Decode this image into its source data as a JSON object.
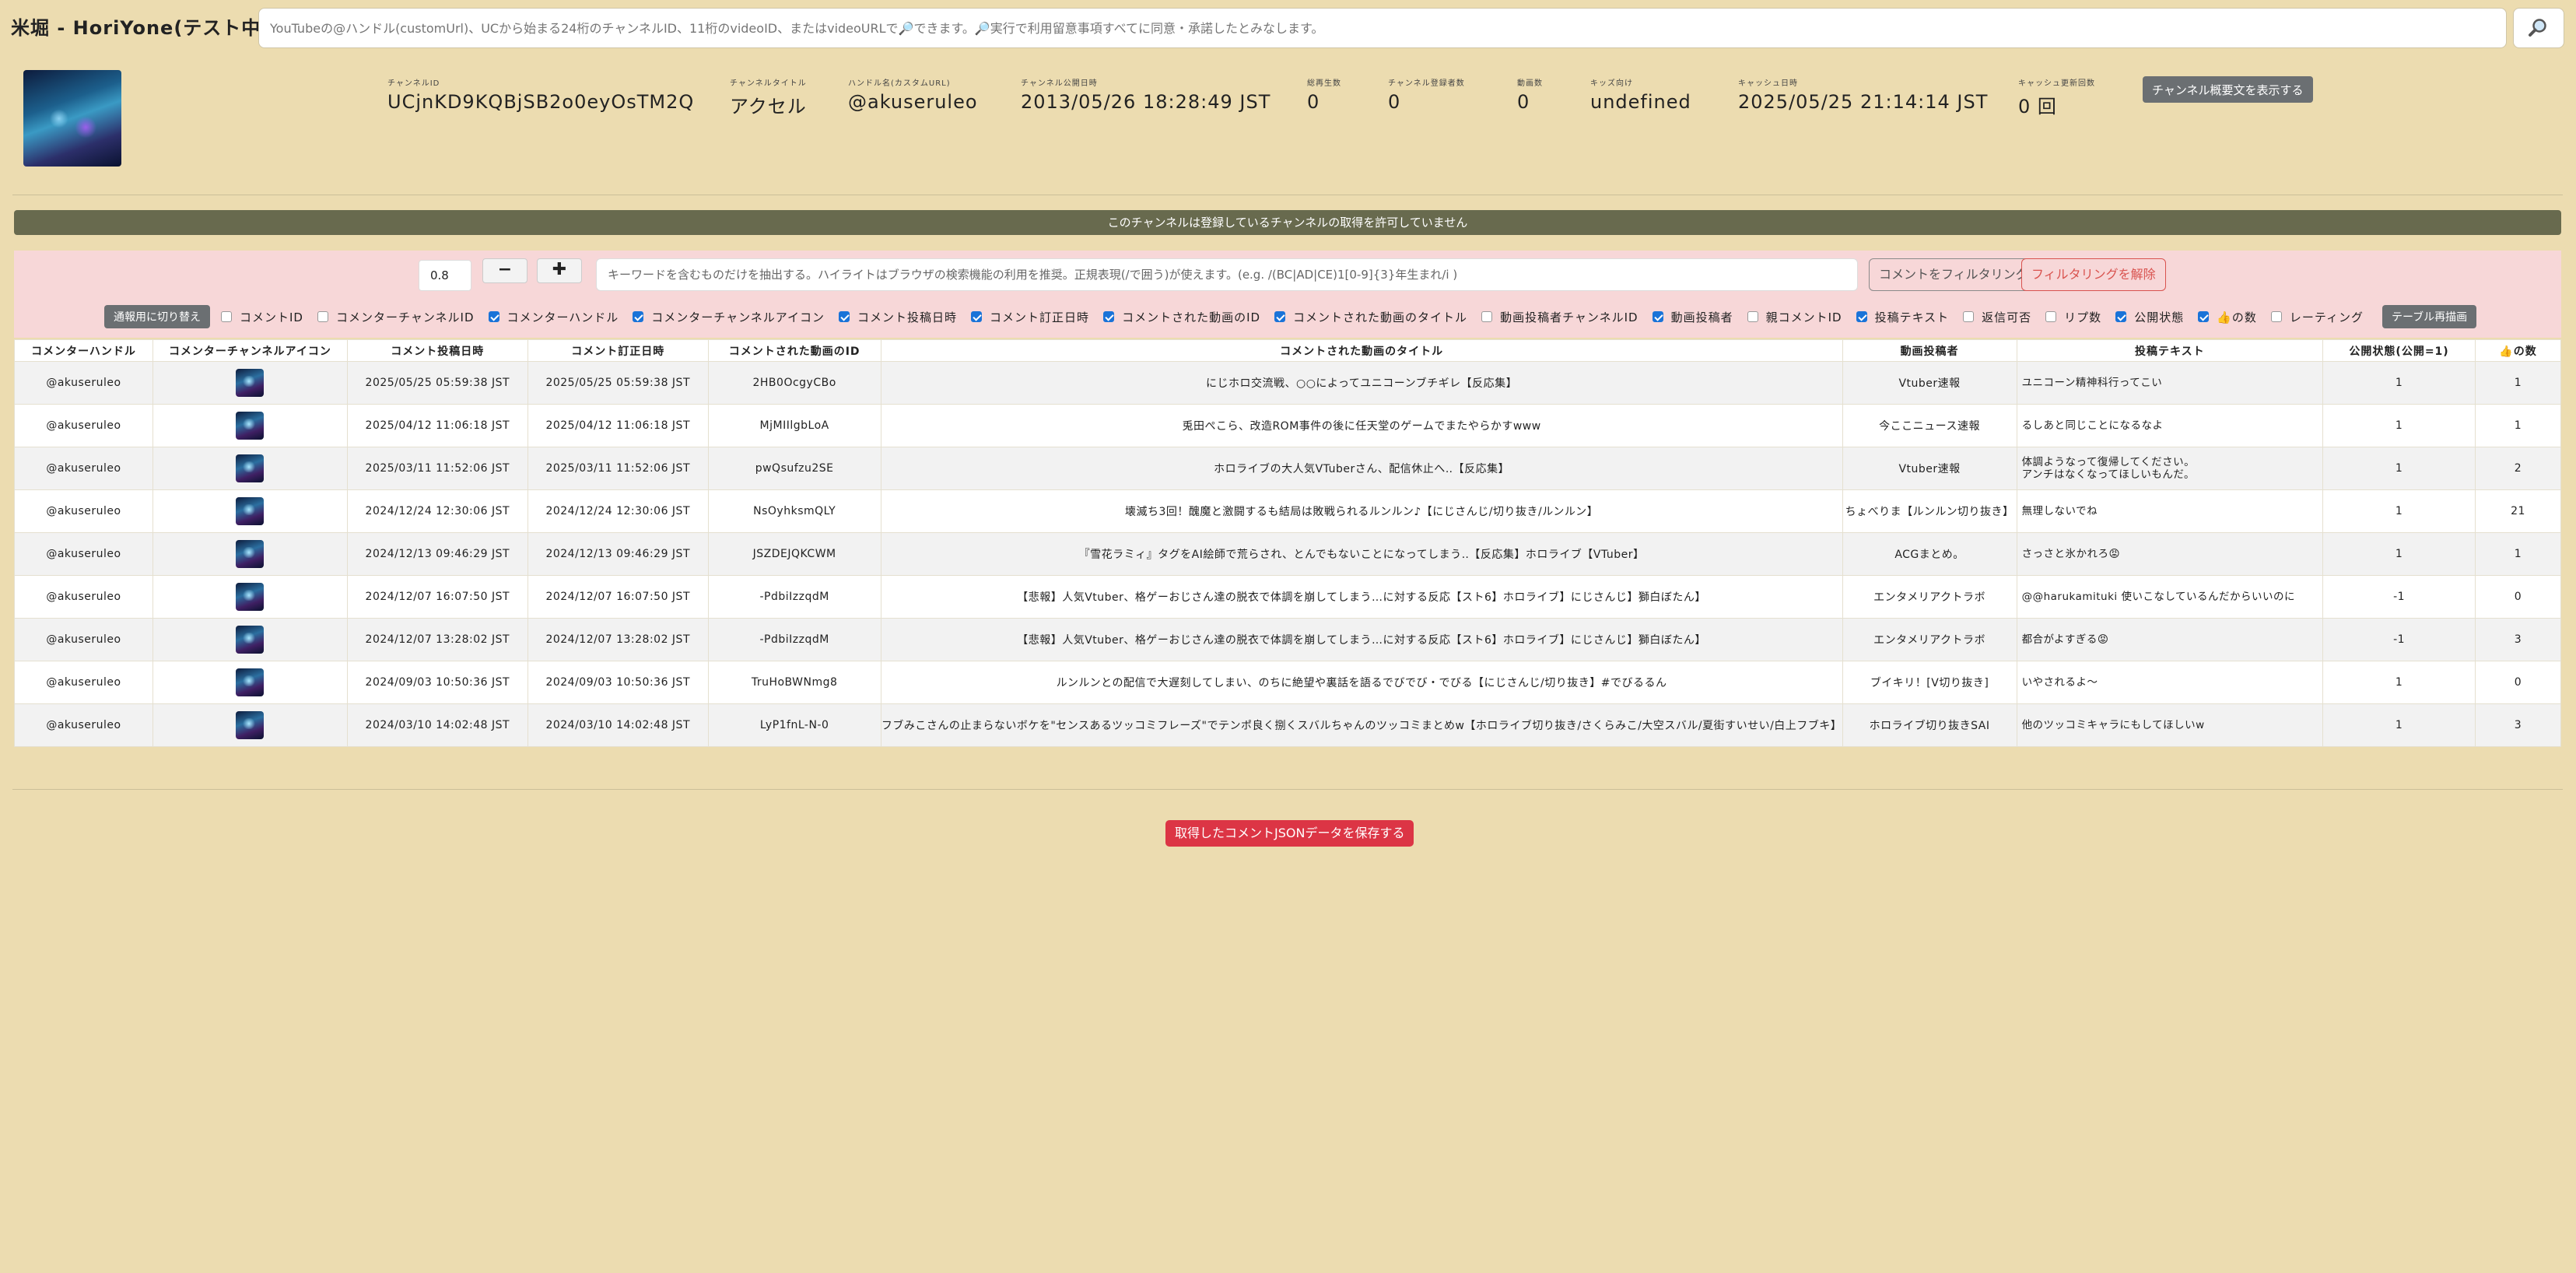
{
  "app_title": "米堀 - HoriYone(テスト中)",
  "search": {
    "placeholder": "YouTubeの@ハンドル(customUrl)、UCから始まる24桁のチャンネルID、11桁のvideoID、またはvideoURLで🔎できます。🔎実行で利用留意事項すべてに同意・承諾したとみなします。",
    "button_icon": "magnifier-icon"
  },
  "channel": {
    "fields": [
      {
        "label": "チャンネルID",
        "value": "UCjnKD9KQBjSB2o0eyOsTM2Q"
      },
      {
        "label": "チャンネルタイトル",
        "value": "アクセル"
      },
      {
        "label": "ハンドル名(カスタムURL)",
        "value": "@akuseruleo"
      },
      {
        "label": "チャンネル公開日時",
        "value": "2013/05/26 18:28:49 JST"
      },
      {
        "label": "総再生数",
        "value": "0"
      },
      {
        "label": "チャンネル登録者数",
        "value": "0"
      },
      {
        "label": "動画数",
        "value": "0"
      },
      {
        "label": "キッズ向け",
        "value": "undefined"
      },
      {
        "label": "キャッシュ日時",
        "value": "2025/05/25 21:14:14 JST"
      },
      {
        "label": "キャッシュ更新回数",
        "value": "0 回"
      }
    ],
    "show_desc_button": "チャンネル概要文を表示する"
  },
  "notice": "このチャンネルは登録しているチャンネルの取得を許可していません",
  "filter": {
    "opacity_value": "0.8",
    "minus_label": "−",
    "plus_label": "✚",
    "keyword_placeholder": "キーワードを含むものだけを抽出する。ハイライトはブラウザの検索機能の利用を推奨。正規表現(/で囲う)が使えます。(e.g. /(BC|AD|CE)1[0-9]{3}年生まれ/i )",
    "filter_button": "コメントをフィルタリング",
    "clear_button": "フィルタリングを解除",
    "mode_toggle_button": "通報用に切り替え",
    "redraw_button": "テーブル再描画",
    "columns": [
      {
        "label": "コメントID",
        "checked": false
      },
      {
        "label": "コメンターチャンネルID",
        "checked": false
      },
      {
        "label": "コメンターハンドル",
        "checked": true
      },
      {
        "label": "コメンターチャンネルアイコン",
        "checked": true
      },
      {
        "label": "コメント投稿日時",
        "checked": true
      },
      {
        "label": "コメント訂正日時",
        "checked": true
      },
      {
        "label": "コメントされた動画のID",
        "checked": true
      },
      {
        "label": "コメントされた動画のタイトル",
        "checked": true
      },
      {
        "label": "動画投稿者チャンネルID",
        "checked": false
      },
      {
        "label": "動画投稿者",
        "checked": true
      },
      {
        "label": "親コメントID",
        "checked": false
      },
      {
        "label": "投稿テキスト",
        "checked": true
      },
      {
        "label": "返信可否",
        "checked": false
      },
      {
        "label": "リプ数",
        "checked": false
      },
      {
        "label": "公開状態",
        "checked": true
      },
      {
        "label": "👍の数",
        "checked": true
      },
      {
        "label": "レーティング",
        "checked": false
      }
    ]
  },
  "table": {
    "headers": [
      "コメンターハンドル",
      "コメンターチャンネルアイコン",
      "コメント投稿日時",
      "コメント訂正日時",
      "コメントされた動画のID",
      "コメントされた動画のタイトル",
      "動画投稿者",
      "投稿テキスト",
      "公開状態(公開=1)",
      "👍の数"
    ],
    "rows": [
      [
        "@akuseruleo",
        "",
        "2025/05/25 05:59:38 JST",
        "2025/05/25 05:59:38 JST",
        "2HB0OcgyCBo",
        "にじホロ交流戦、○○によってユニコーンブチギレ【反応集】",
        "Vtuber速報",
        "ユニコーン精神科行ってこい",
        "1",
        "1"
      ],
      [
        "@akuseruleo",
        "",
        "2025/04/12 11:06:18 JST",
        "2025/04/12 11:06:18 JST",
        "MjMIIlgbLoA",
        "兎田ぺこら、改造ROM事件の後に任天堂のゲームでまたやらかすwww",
        "今ここニュース速報",
        "るしあと同じことになるなよ",
        "1",
        "1"
      ],
      [
        "@akuseruleo",
        "",
        "2025/03/11 11:52:06 JST",
        "2025/03/11 11:52:06 JST",
        "pwQsufzu2SE",
        "ホロライブの大人気VTuberさん、配信休止へ‥【反応集】",
        "Vtuber速報",
        "体調ようなって復帰してください。\nアンチはなくなってほしいもんだ。",
        "1",
        "2"
      ],
      [
        "@akuseruleo",
        "",
        "2024/12/24 12:30:06 JST",
        "2024/12/24 12:30:06 JST",
        "NsOyhksmQLY",
        "壊滅ち3回！醜魔と激闘するも結局は敗戦られるルンルン♪【にじさんじ/切り抜き/ルンルン】",
        "ちょべりま【ルンルン切り抜き】",
        "無理しないでね",
        "1",
        "21"
      ],
      [
        "@akuseruleo",
        "",
        "2024/12/13 09:46:29 JST",
        "2024/12/13 09:46:29 JST",
        "JSZDEJQKCWM",
        "『雪花ラミィ』タグをAI絵師で荒らされ、とんでもないことになってしまう‥【反応集】ホロライブ【VTuber】",
        "ACGまとめ。",
        "さっさと氷かれろ😡",
        "1",
        "1"
      ],
      [
        "@akuseruleo",
        "",
        "2024/12/07 16:07:50 JST",
        "2024/12/07 16:07:50 JST",
        "-PdbiIzzqdM",
        "【悲報】人気Vtuber、格ゲーおじさん達の脱衣で体調を崩してしまう…に対する反応【スト6】ホロライブ】にじさんじ】獅白ぼたん】",
        "エンタメリアクトラボ",
        "@@harukamituki 使いこなしているんだからいいのに",
        "-1",
        "0"
      ],
      [
        "@akuseruleo",
        "",
        "2024/12/07 13:28:02 JST",
        "2024/12/07 13:28:02 JST",
        "-PdbiIzzqdM",
        "【悲報】人気Vtuber、格ゲーおじさん達の脱衣で体調を崩してしまう…に対する反応【スト6】ホロライブ】にじさんじ】獅白ぼたん】",
        "エンタメリアクトラボ",
        "都合がよすぎる😡",
        "-1",
        "3"
      ],
      [
        "@akuseruleo",
        "",
        "2024/09/03 10:50:36 JST",
        "2024/09/03 10:50:36 JST",
        "TruHoBWNmg8",
        "ルンルンとの配信で大遅刻してしまい、のちに絶望や裏話を語るでびでび・でびる【にじさんじ/切り抜き】#でびるるん",
        "ブイキリ！[V切り抜き]",
        "いやされるよ～",
        "1",
        "0"
      ],
      [
        "@akuseruleo",
        "",
        "2024/03/10 14:02:48 JST",
        "2024/03/10 14:02:48 JST",
        "LyP1fnL-N-0",
        "フブみこさんの止まらないボケを\"センスあるツッコミフレーズ\"でテンポ良く捌くスバルちゃんのツッコミまとめw【ホロライブ切り抜き/さくらみこ/大空スバル/夏街すいせい/白上フブキ】",
        "ホロライブ切り抜きSAI",
        "他のツッコミキャラにもしてほしいw",
        "1",
        "3"
      ]
    ]
  },
  "save_button": "取得したコメントJSONデータを保存する"
}
